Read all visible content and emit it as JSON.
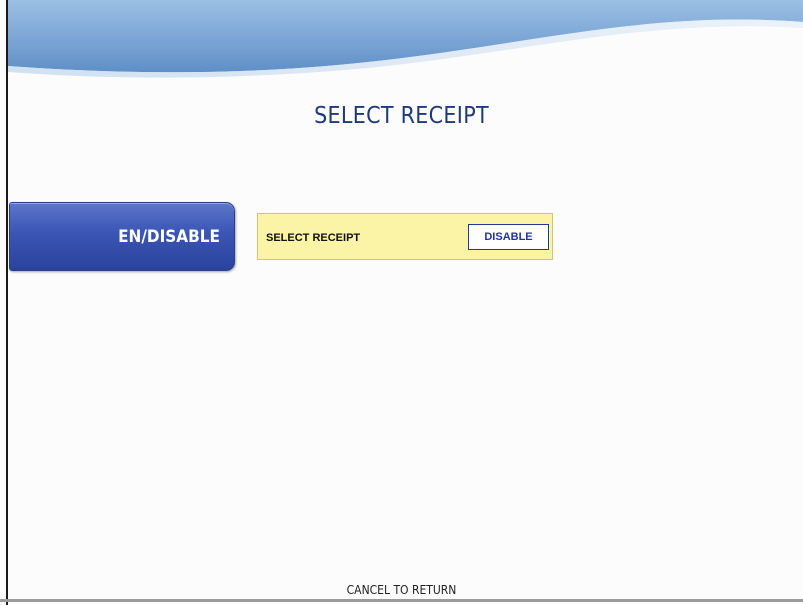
{
  "screen": {
    "title": "SELECT RECEIPT",
    "footer": "CANCEL TO RETURN"
  },
  "side_button": {
    "label": "EN/DISABLE",
    "color": "#3a55b4"
  },
  "setting": {
    "label": "SELECT RECEIPT",
    "value": "DISABLE",
    "background_color": "#fbf4a6"
  },
  "theme": {
    "title_color": "#1f3a7a",
    "header_color": "#7aa6d6"
  }
}
